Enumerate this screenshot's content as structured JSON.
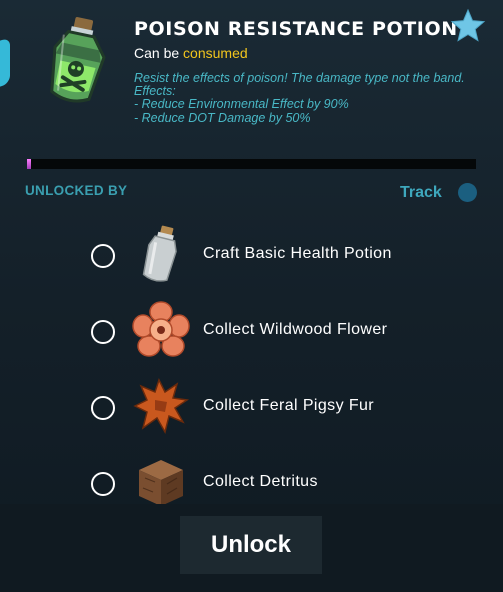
{
  "item": {
    "title": "Poison Resistance Potion",
    "subtitle_prefix": "Can be ",
    "subtitle_status": "consumed",
    "description": "Resist the effects of poison! The damage type not the band.\n    Effects:\n      - Reduce Environmental Effect by 90%\n      - Reduce DOT Damage by 50%",
    "icon": "poison-potion-icon",
    "favorite_icon": "star-icon"
  },
  "progress": {
    "fraction": 0.01
  },
  "unlock_section": {
    "label": "UNLOCKED BY",
    "track_label": "Track"
  },
  "requirements": [
    {
      "label": "Craft Basic Health Potion",
      "icon": "empty-bottle-icon",
      "checked": false
    },
    {
      "label": "Collect Wildwood Flower",
      "icon": "wildwood-flower-icon",
      "checked": false
    },
    {
      "label": "Collect Feral Pigsy Fur",
      "icon": "pigsy-fur-icon",
      "checked": false
    },
    {
      "label": "Collect Detritus",
      "icon": "detritus-block-icon",
      "checked": false
    }
  ],
  "actions": {
    "unlock_label": "Unlock"
  },
  "colors": {
    "accent": "#3ea8bd",
    "description": "#49b8c6",
    "highlight": "#f2c51d",
    "star": "#6fc6e6",
    "progress": "#e066f0"
  }
}
